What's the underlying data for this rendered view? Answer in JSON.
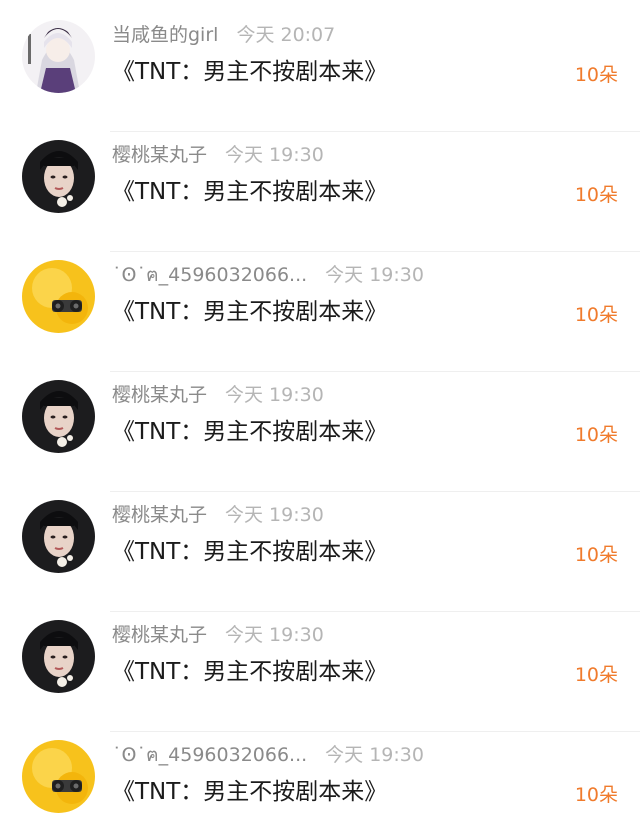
{
  "colors": {
    "count_accent": "#f07b2c",
    "username": "#8a8a8a",
    "timestamp": "#b5b5b5",
    "title": "#1b1b1b"
  },
  "rows": [
    {
      "avatar": "anime-girl-avatar",
      "username": "当咸鱼的girl",
      "time": "今天 20:07",
      "title": "《TNT：男主不按剧本来》",
      "count": "10朵"
    },
    {
      "avatar": "portrait-avatar",
      "username": "樱桃某丸子",
      "time": "今天 19:30",
      "title": "《TNT：男主不按剧本来》",
      "count": "10朵"
    },
    {
      "avatar": "yellow-camera-avatar",
      "username": "˙Ꙩ˙ฅ_4596032066...",
      "time": "今天 19:30",
      "title": "《TNT：男主不按剧本来》",
      "count": "10朵"
    },
    {
      "avatar": "portrait-avatar",
      "username": "樱桃某丸子",
      "time": "今天 19:30",
      "title": "《TNT：男主不按剧本来》",
      "count": "10朵"
    },
    {
      "avatar": "portrait-avatar",
      "username": "樱桃某丸子",
      "time": "今天 19:30",
      "title": "《TNT：男主不按剧本来》",
      "count": "10朵"
    },
    {
      "avatar": "portrait-avatar",
      "username": "樱桃某丸子",
      "time": "今天 19:30",
      "title": "《TNT：男主不按剧本来》",
      "count": "10朵"
    },
    {
      "avatar": "yellow-camera-avatar",
      "username": "˙Ꙩ˙ฅ_4596032066...",
      "time": "今天 19:30",
      "title": "《TNT：男主不按剧本来》",
      "count": "10朵"
    }
  ]
}
